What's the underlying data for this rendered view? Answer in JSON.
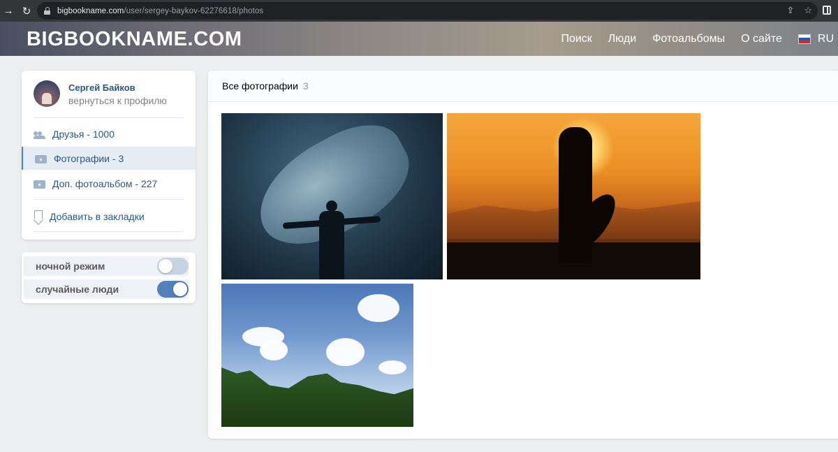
{
  "browser": {
    "url_host": "bigbookname.com",
    "url_path": "/user/sergey-baykov-62276618/photos",
    "icons": [
      "arrow-right-icon",
      "reload-icon",
      "lock-icon",
      "share-icon",
      "star-icon",
      "extensions-icon"
    ]
  },
  "header": {
    "logo": "BIGBOOKNAME.COM",
    "nav": [
      "Поиск",
      "Люди",
      "Фотоальбомы",
      "О сайте"
    ],
    "lang": "RU",
    "flag_colors": [
      "#ffffff",
      "#1c57c4",
      "#d52b1e"
    ]
  },
  "profile": {
    "name": "Сергей Байков",
    "back_link": "вернуться к профилю",
    "menu": [
      {
        "label": "Друзья - 1000",
        "icon": "friends-icon"
      },
      {
        "label": "Фотографии - 3",
        "icon": "camera-icon",
        "active": true
      },
      {
        "label": "Доп. фотоальбом - 227",
        "icon": "camera-icon"
      }
    ],
    "bookmark": "Добавить в закладки"
  },
  "settings": {
    "night_mode": {
      "label": "ночной режим",
      "on": false
    },
    "random_people": {
      "label": "случайные люди",
      "on": true
    }
  },
  "photos": {
    "title": "Все фотографии",
    "count": "3",
    "items": [
      "photo-whale",
      "photo-sunset-guitar",
      "photo-sky-trees"
    ]
  },
  "colors": {
    "accent": "#5181b8",
    "link": "#2a5885",
    "page_bg": "#edeef0"
  }
}
